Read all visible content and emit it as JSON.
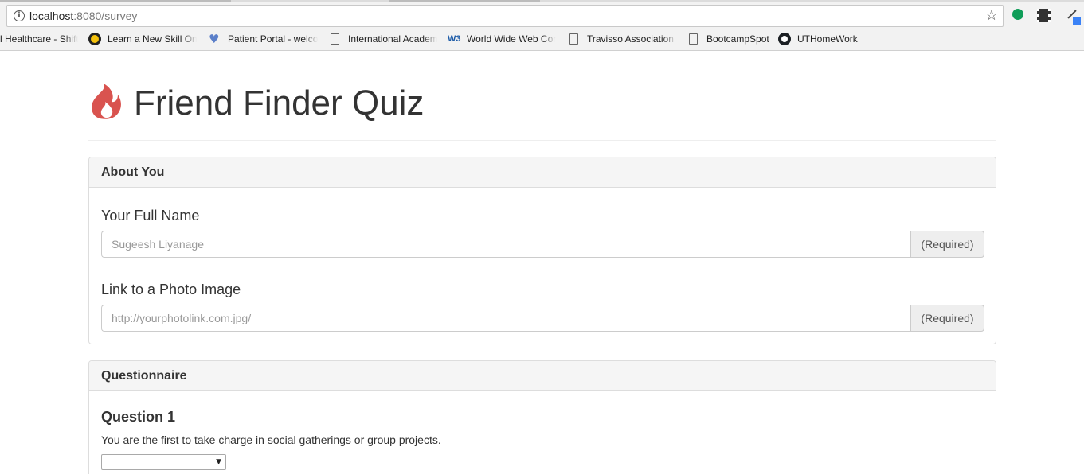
{
  "browser": {
    "url_host": "localhost",
    "url_rest": ":8080/survey",
    "bookmarks": [
      {
        "label": "l Healthcare - Shift",
        "icon": "none"
      },
      {
        "label": "Learn a New Skill Onl",
        "icon": "learn-icon"
      },
      {
        "label": "Patient Portal - welco",
        "icon": "heart-icon"
      },
      {
        "label": "International Academ",
        "icon": "document-icon"
      },
      {
        "label": "World Wide Web Cor",
        "icon": "w3c-icon"
      },
      {
        "label": "Travisso Association -",
        "icon": "document-icon"
      },
      {
        "label": "BootcampSpot",
        "icon": "document-icon"
      },
      {
        "label": "UTHomeWork",
        "icon": "github-icon"
      }
    ],
    "w3_glyph": "W3"
  },
  "page": {
    "title": "Friend Finder Quiz",
    "accent_color": "#d9534f"
  },
  "about": {
    "heading": "About You",
    "name_label": "Your Full Name",
    "name_placeholder": "Sugeesh Liyanage",
    "name_addon": "(Required)",
    "photo_label": "Link to a Photo Image",
    "photo_placeholder": "http://yourphotolink.com.jpg/",
    "photo_addon": "(Required)"
  },
  "questionnaire": {
    "heading": "Questionnaire",
    "questions": [
      {
        "title": "Question 1",
        "text": "You are the first to take charge in social gatherings or group projects.",
        "selected": ""
      }
    ]
  }
}
